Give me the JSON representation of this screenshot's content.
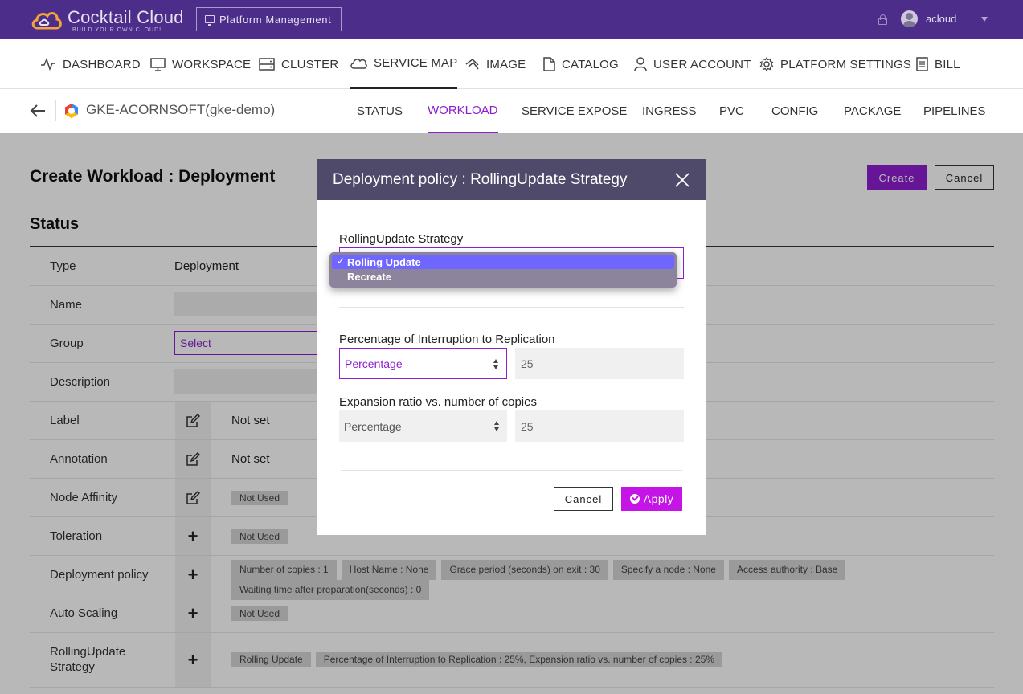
{
  "header": {
    "brand": "Cocktail Cloud",
    "tagline": "BUILD YOUR OWN CLOUD!",
    "platform_button": "Platform Management",
    "username": "acloud"
  },
  "main_nav": [
    {
      "label": "DASHBOARD",
      "icon": "pulse-icon"
    },
    {
      "label": "WORKSPACE",
      "icon": "monitor-icon"
    },
    {
      "label": "CLUSTER",
      "icon": "server-icon"
    },
    {
      "label": "SERVICE MAP",
      "icon": "cloud-icon",
      "active": true
    },
    {
      "label": "IMAGE",
      "icon": "image-icon"
    },
    {
      "label": "CATALOG",
      "icon": "document-icon"
    },
    {
      "label": "USER ACCOUNT",
      "icon": "user-icon"
    },
    {
      "label": "PLATFORM SETTINGS",
      "icon": "gear-icon"
    },
    {
      "label": "BILL",
      "icon": "bill-icon"
    }
  ],
  "sub_nav": {
    "cluster": "GKE-ACORNSOFT(gke-demo)",
    "tabs": [
      {
        "label": "STATUS"
      },
      {
        "label": "WORKLOAD",
        "active": true
      },
      {
        "label": "SERVICE EXPOSE"
      },
      {
        "label": "INGRESS"
      },
      {
        "label": "PVC"
      },
      {
        "label": "CONFIG"
      },
      {
        "label": "PACKAGE"
      },
      {
        "label": "PIPELINES"
      }
    ]
  },
  "page": {
    "title": "Create Workload : Deployment",
    "create_button": "Create",
    "cancel_button": "Cancel",
    "section": "Status",
    "rows": {
      "type": {
        "label": "Type",
        "value": "Deployment"
      },
      "name": {
        "label": "Name"
      },
      "group": {
        "label": "Group",
        "value": "Select"
      },
      "description": {
        "label": "Description"
      },
      "label": {
        "label": "Label",
        "value": "Not set"
      },
      "annotation": {
        "label": "Annotation",
        "value": "Not set"
      },
      "node_affinity": {
        "label": "Node Affinity",
        "chip": "Not Used"
      },
      "toleration": {
        "label": "Toleration",
        "chip": "Not Used"
      },
      "deployment_policy": {
        "label": "Deployment policy",
        "chips": [
          "Number of copies : 1",
          "Host Name : None",
          "Grace period (seconds) on exit : 30",
          "Specify a node : None",
          "Access authority : Base",
          "Waiting time after preparation(seconds) : 0"
        ]
      },
      "auto_scaling": {
        "label": "Auto Scaling",
        "chip": "Not Used"
      },
      "rolling_update": {
        "label_line1": "RollingUpdate",
        "label_line2": "Strategy",
        "chips": [
          "Rolling Update",
          "Percentage of Interruption to Replication : 25%, Expansion ratio vs. number of copies : 25%"
        ]
      }
    }
  },
  "modal": {
    "title": "Deployment policy : RollingUpdate Strategy",
    "strategy_label": "RollingUpdate Strategy",
    "strategy_options": [
      "Rolling Update",
      "Recreate"
    ],
    "strategy_selected": "Rolling Update",
    "interruption_label": "Percentage of Interruption to Replication",
    "interruption_unit": "Percentage",
    "interruption_value": "25",
    "expansion_label": "Expansion ratio vs. number of copies",
    "expansion_unit": "Percentage",
    "expansion_value": "25",
    "cancel_button": "Cancel",
    "apply_button": "Apply"
  }
}
